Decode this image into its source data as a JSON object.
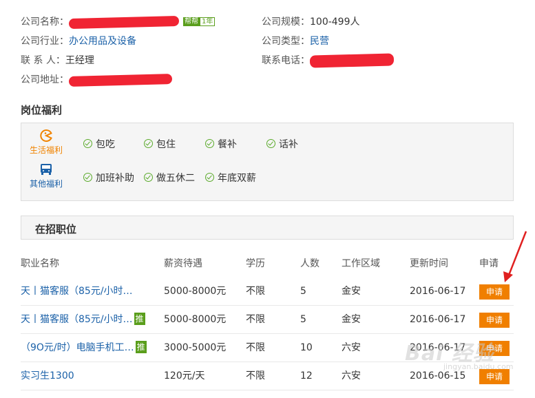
{
  "company": {
    "name_label": "公司名称：",
    "badge_main": "帮帮",
    "badge_year": "1年",
    "scale_label": "公司规模：",
    "scale_value": "100-499人",
    "industry_label": "公司行业：",
    "industry_value": "办公用品及设备",
    "type_label": "公司类型：",
    "type_value": "民营",
    "contact_label": "联 系 人：",
    "contact_value": "王经理",
    "phone_label": "联系电话：",
    "address_label": "公司地址："
  },
  "welfare": {
    "title": "岗位福利",
    "life_label": "生活福利",
    "other_label": "其他福利",
    "life_items": [
      "包吃",
      "包住",
      "餐补",
      "话补"
    ],
    "other_items": [
      "加班补助",
      "做五休二",
      "年底双薪"
    ]
  },
  "jobs": {
    "title": "在招职位",
    "headers": [
      "职业名称",
      "薪资待遇",
      "学历",
      "人数",
      "工作区域",
      "更新时间",
      "申请"
    ],
    "apply_label": "申请",
    "push_tag": "推",
    "rows": [
      {
        "name": "天丨猫客服（85元/小时…",
        "salary": "5000-8000元",
        "edu": "不限",
        "count": "5",
        "area": "金安",
        "date": "2016-06-17",
        "tag": ""
      },
      {
        "name": "天丨猫客服（85元/小时…",
        "salary": "5000-8000元",
        "edu": "不限",
        "count": "5",
        "area": "金安",
        "date": "2016-06-17",
        "tag": "推"
      },
      {
        "name": "（9O元/时）电脑手机工…",
        "salary": "3000-5000元",
        "edu": "不限",
        "count": "10",
        "area": "六安",
        "date": "2016-06-17",
        "tag": "推"
      },
      {
        "name": "实习生1300",
        "salary": "120元/天",
        "edu": "不限",
        "count": "12",
        "area": "六安",
        "date": "2016-06-15",
        "tag": ""
      }
    ]
  },
  "watermark": {
    "text": "Bai 经验",
    "sub": "jingyan.baidu.com"
  },
  "colors": {
    "link": "#1b61a8",
    "accent": "#f07f00",
    "green": "#5a9e1c",
    "redaction": "#f02433"
  },
  "icons": {
    "life": "pacman-icon",
    "other": "bus-icon",
    "check": "check-circle-icon"
  }
}
